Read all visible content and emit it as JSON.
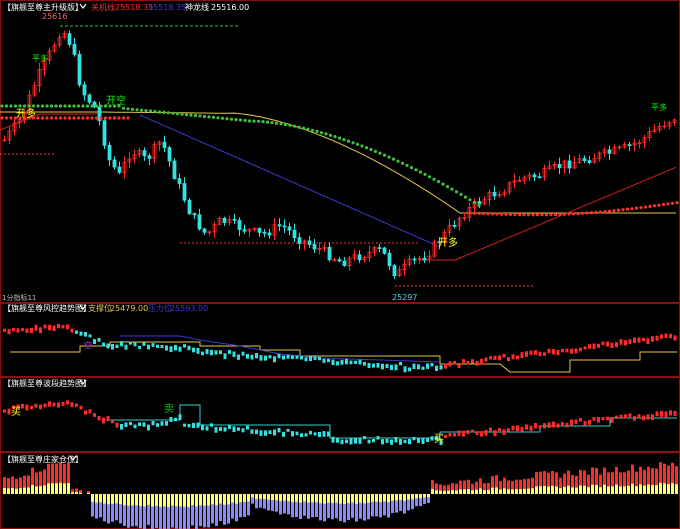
{
  "colors": {
    "bg": "#000000",
    "up": "#ff2a2a",
    "down": "#35e0e0",
    "green_dots": "#3fbf3f",
    "red_dots": "#ff3030",
    "yellow": "#e6c84a",
    "blue": "#3a3acf",
    "purple": "#8a8aff",
    "frame": "#8a1010",
    "label_white": "#ffffff",
    "label_yellow": "#ffff00",
    "label_green": "#00ff00",
    "buy_sell_green": "#00c000"
  },
  "panel1": {
    "title": "【旗舰至尊主升级版】",
    "chevron_icon": "chevron-down-icon",
    "ind1_name": "关机线",
    "ind1_value": "25518.35",
    "ind2_value": "25518.35",
    "ind3_name": "神龙线",
    "ind3_value": "25516.00",
    "peak_label": "25616",
    "low_label": "25297",
    "label_pingduo": "平多",
    "label_kaiduo": "开多",
    "label_kaikong": "开空",
    "label_kaiduo2": "开多",
    "label_pingduo2": "平多",
    "bottom_caption": "1分指标11"
  },
  "panel2": {
    "title": "【旗舰至尊风控趋势图】",
    "ind1_name": "支撑位",
    "ind1_value": "25479.00",
    "ind2_name": "压力位",
    "ind2_value": "25593.00",
    "label_kong": "空"
  },
  "panel3": {
    "title": "【旗舰至尊波段趋势图】",
    "label_mai1": "买",
    "label_mai2": "卖",
    "label_mai3": "买"
  },
  "panel4": {
    "title": "【旗舰至尊庄家仓位】"
  }
}
